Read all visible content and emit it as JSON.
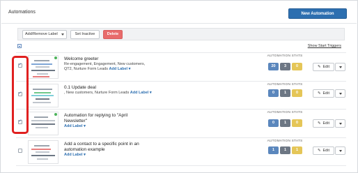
{
  "header": {
    "title": "Automations",
    "new_button": "New Automation"
  },
  "toolbar": {
    "label_select": "Add/Remove Label",
    "set_inactive": "Set Inactive",
    "delete": "Delete"
  },
  "show_triggers": "Show Start Triggers",
  "stats_heading": "AUTOMATION STATS",
  "edit_label": "Edit",
  "add_label": "Add Label ▾",
  "automations": [
    {
      "title": "Welcome greeter",
      "meta": "Re-engagement, Engagement, New customers, QT2, Nurture Form Leads",
      "checked": true,
      "stats": [
        "20",
        "3",
        "0"
      ]
    },
    {
      "title": "0.1 Update deal",
      "meta": ", New customers, Nurture Form Leads",
      "checked": true,
      "stats": [
        "0",
        "1",
        "0"
      ]
    },
    {
      "title": "Automation for replying to \"April Newsletter\"",
      "meta": "",
      "checked": true,
      "stats": [
        "0",
        "1",
        "0"
      ]
    },
    {
      "title": "Add a contact to a specific point in an automation example",
      "meta": "",
      "checked": false,
      "stats": [
        "1",
        "1",
        "1"
      ]
    }
  ],
  "colors": {
    "primary": "#2d6fb0",
    "delete": "#e86b6b",
    "stat_blue": "#5b87bd",
    "stat_gray": "#6d7784",
    "stat_yellow": "#e5c658",
    "highlight": "#e02020"
  }
}
